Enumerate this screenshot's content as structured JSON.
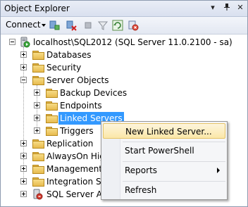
{
  "panel": {
    "title": "Object Explorer",
    "pin_glyph": "▾",
    "autohide_glyph": "📌",
    "close_glyph": "✕"
  },
  "toolbar": {
    "connect_label": "Connect",
    "buttons": [
      "connect-object-explorer-icon",
      "disconnect-icon",
      "stop-icon",
      "filter-icon",
      "refresh-icon",
      "sync-icon"
    ]
  },
  "tree": {
    "server_label": "localhost\\SQL2012 (SQL Server 11.0.2100 - sa)",
    "databases": "Databases",
    "security": "Security",
    "server_objects": "Server Objects",
    "backup_devices": "Backup Devices",
    "endpoints": "Endpoints",
    "linked_servers": "Linked Servers",
    "triggers": "Triggers",
    "replication": "Replication",
    "alwayson": "AlwaysOn High Availability",
    "management": "Management",
    "integration": "Integration Services Catalogs",
    "agent": "SQL Server Agent"
  },
  "context_menu": {
    "new_linked_server": "New Linked Server...",
    "start_powershell": "Start PowerShell",
    "reports": "Reports",
    "refresh": "Refresh"
  },
  "colors": {
    "selection": "#3399ff",
    "menu_highlight": "#fbe7a8"
  }
}
